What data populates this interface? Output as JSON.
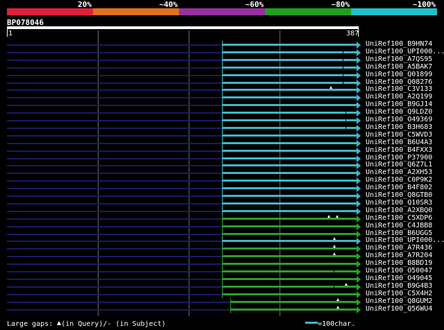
{
  "scale": {
    "segments": [
      {
        "label": "20%",
        "color": "#e01e3c"
      },
      {
        "label": "~40%",
        "color": "#e07020"
      },
      {
        "label": "~60%",
        "color": "#9a30a0"
      },
      {
        "label": "~80%",
        "color": "#20a020"
      },
      {
        "label": "~100%",
        "color": "#20c0c8"
      }
    ]
  },
  "query": {
    "id": "BP078046",
    "start": "1",
    "end": "387"
  },
  "colors": {
    "cyan": "#40b8c8",
    "green": "#2aa02a",
    "background_line": "#1a1a66"
  },
  "hits": [
    {
      "label": "UniRef100_B9HN74",
      "color": "cyan",
      "start": 1,
      "end": 387,
      "qgaps": [],
      "sgaps": [],
      "cap": true
    },
    {
      "label": "UniRef100_UPI000...",
      "color": "cyan",
      "start": 1,
      "end": 387,
      "qgaps": [],
      "sgaps": [
        370
      ],
      "cap": true
    },
    {
      "label": "UniRef100_A7QS95",
      "color": "cyan",
      "start": 1,
      "end": 387,
      "qgaps": [],
      "sgaps": [
        370
      ],
      "cap": true
    },
    {
      "label": "UniRef100_A5BAK7",
      "color": "cyan",
      "start": 1,
      "end": 387,
      "qgaps": [],
      "sgaps": [
        370
      ],
      "cap": true
    },
    {
      "label": "UniRef100_Q01899",
      "color": "cyan",
      "start": 1,
      "end": 387,
      "qgaps": [],
      "sgaps": [
        370
      ],
      "cap": true
    },
    {
      "label": "UniRef100_Q08276",
      "color": "cyan",
      "start": 1,
      "end": 387,
      "qgaps": [],
      "sgaps": [
        370
      ],
      "cap": true
    },
    {
      "label": "UniRef100_C3V133",
      "color": "cyan",
      "start": 1,
      "end": 387,
      "qgaps": [
        357
      ],
      "sgaps": [],
      "cap": true
    },
    {
      "label": "UniRef100_A2Q199",
      "color": "cyan",
      "start": 1,
      "end": 387,
      "qgaps": [],
      "sgaps": [],
      "cap": true
    },
    {
      "label": "UniRef100_B9GJ14",
      "color": "cyan",
      "start": 1,
      "end": 387,
      "qgaps": [],
      "sgaps": [],
      "cap": true
    },
    {
      "label": "UniRef100_Q9LDZ0",
      "color": "cyan",
      "start": 1,
      "end": 387,
      "qgaps": [],
      "sgaps": [
        373
      ],
      "cap": true
    },
    {
      "label": "UniRef100_O49369",
      "color": "cyan",
      "start": 1,
      "end": 387,
      "qgaps": [],
      "sgaps": [
        373
      ],
      "cap": true
    },
    {
      "label": "UniRef100_B3H683",
      "color": "cyan",
      "start": 1,
      "end": 387,
      "qgaps": [],
      "sgaps": [
        373
      ],
      "cap": true
    },
    {
      "label": "UniRef100_C5WVD3",
      "color": "cyan",
      "start": 1,
      "end": 387,
      "qgaps": [],
      "sgaps": [],
      "cap": true
    },
    {
      "label": "UniRef100_B6U4A3",
      "color": "cyan",
      "start": 1,
      "end": 387,
      "qgaps": [],
      "sgaps": [],
      "cap": true
    },
    {
      "label": "UniRef100_B4FXX3",
      "color": "cyan",
      "start": 1,
      "end": 387,
      "qgaps": [],
      "sgaps": [],
      "cap": true
    },
    {
      "label": "UniRef100_P37900",
      "color": "cyan",
      "start": 1,
      "end": 387,
      "qgaps": [],
      "sgaps": [],
      "cap": true
    },
    {
      "label": "UniRef100_Q6Z7L1",
      "color": "cyan",
      "start": 1,
      "end": 387,
      "qgaps": [],
      "sgaps": [],
      "cap": true
    },
    {
      "label": "UniRef100_A2XH53",
      "color": "cyan",
      "start": 1,
      "end": 387,
      "qgaps": [],
      "sgaps": [],
      "cap": true
    },
    {
      "label": "UniRef100_C0P9K2",
      "color": "cyan",
      "start": 1,
      "end": 387,
      "qgaps": [],
      "sgaps": [],
      "cap": true
    },
    {
      "label": "UniRef100_B4F802",
      "color": "cyan",
      "start": 1,
      "end": 387,
      "qgaps": [],
      "sgaps": [],
      "cap": true
    },
    {
      "label": "UniRef100_Q8GTB0",
      "color": "cyan",
      "start": 1,
      "end": 387,
      "qgaps": [],
      "sgaps": [],
      "cap": true
    },
    {
      "label": "UniRef100_Q10SR3",
      "color": "cyan",
      "start": 1,
      "end": 387,
      "qgaps": [],
      "sgaps": [],
      "cap": true
    },
    {
      "label": "UniRef100_A2XBQ0",
      "color": "cyan",
      "start": 1,
      "end": 387,
      "qgaps": [],
      "sgaps": [],
      "cap": true
    },
    {
      "label": "UniRef100_C5XDP6",
      "color": "green",
      "start": 1,
      "end": 387,
      "qgaps": [
        355,
        364
      ],
      "sgaps": [],
      "cap": true
    },
    {
      "label": "UniRef100_C4JBB8",
      "color": "green",
      "start": 1,
      "end": 387,
      "qgaps": [],
      "sgaps": [],
      "cap": true
    },
    {
      "label": "UniRef100_B6UGG5",
      "color": "green",
      "start": 1,
      "end": 387,
      "qgaps": [],
      "sgaps": [],
      "cap": true
    },
    {
      "label": "UniRef100_UPI000...",
      "color": "cyan",
      "start": 1,
      "end": 387,
      "qgaps": [
        361
      ],
      "sgaps": [],
      "cap": true
    },
    {
      "label": "UniRef100_A7R436",
      "color": "green",
      "start": 1,
      "end": 387,
      "qgaps": [
        361
      ],
      "sgaps": [],
      "cap": true
    },
    {
      "label": "UniRef100_A7R204",
      "color": "green",
      "start": 1,
      "end": 387,
      "qgaps": [
        361
      ],
      "sgaps": [],
      "cap": true
    },
    {
      "label": "UniRef100_B8BD19",
      "color": "green",
      "start": 1,
      "end": 387,
      "qgaps": [],
      "sgaps": [],
      "cap": true
    },
    {
      "label": "UniRef100_O50047",
      "color": "green",
      "start": 1,
      "end": 387,
      "qgaps": [],
      "sgaps": [
        360
      ],
      "cap": true
    },
    {
      "label": "UniRef100_O49045",
      "color": "green",
      "start": 1,
      "end": 387,
      "qgaps": [],
      "sgaps": [],
      "cap": true
    },
    {
      "label": "UniRef100_B9G4B3",
      "color": "green",
      "start": 1,
      "end": 387,
      "qgaps": [
        374
      ],
      "sgaps": [
        360
      ],
      "cap": true
    },
    {
      "label": "UniRef100_C5X4H2",
      "color": "green",
      "start": 1,
      "end": 387,
      "qgaps": [],
      "sgaps": [],
      "cap": true
    },
    {
      "label": "UniRef100_Q8GUM2",
      "color": "green",
      "start": 11,
      "end": 387,
      "qgaps": [
        365
      ],
      "sgaps": [],
      "cap": false
    },
    {
      "label": "UniRef100_Q56WU4",
      "color": "green",
      "start": 11,
      "end": 387,
      "qgaps": [
        365
      ],
      "sgaps": [],
      "cap": false
    }
  ],
  "legend": {
    "prefix": "Large gaps:",
    "query_gap": "(in Query)/",
    "subject_gap": "- (in Subject)"
  },
  "scale_legend": "=100char."
}
